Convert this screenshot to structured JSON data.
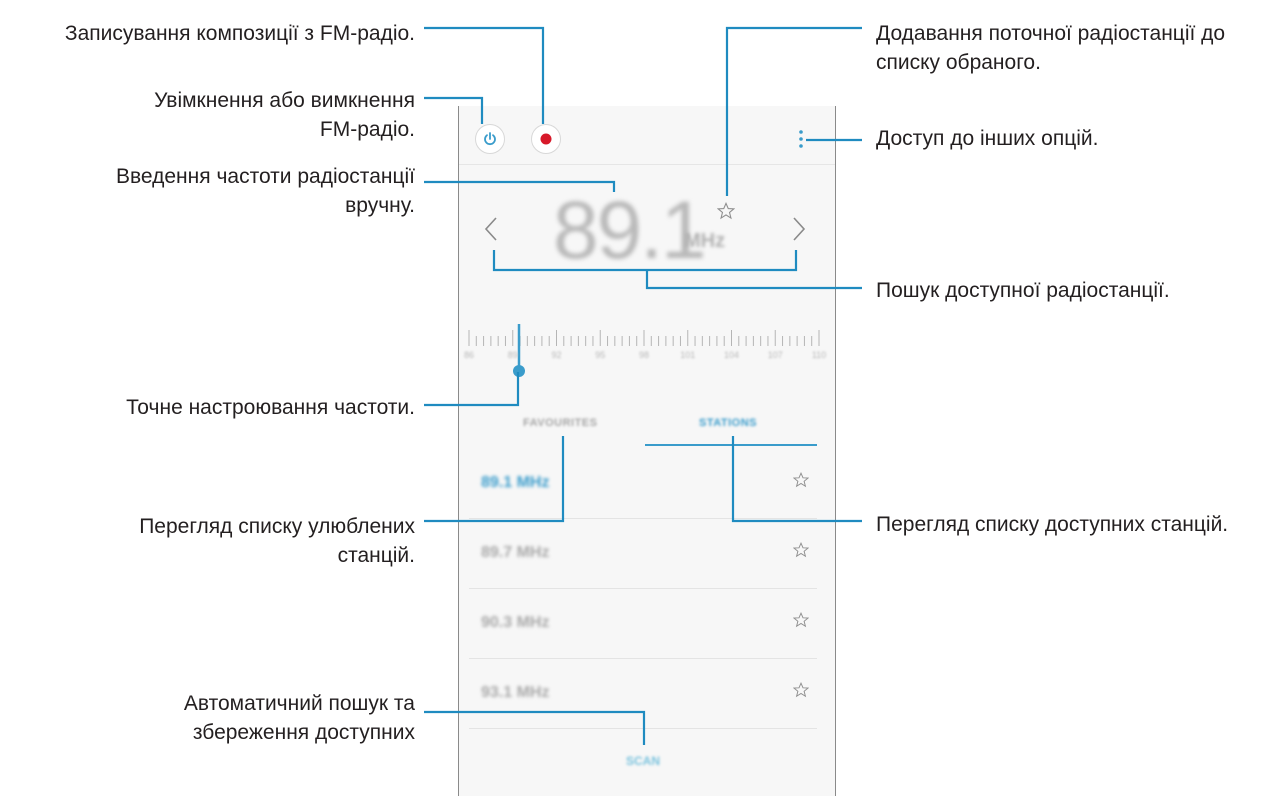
{
  "callouts": {
    "record": [
      "Записування композиції з FM-радіо."
    ],
    "power": [
      "Увімкнення або вимкнення",
      "FM-радіо."
    ],
    "manual_freq": [
      "Введення частоти радіостанції",
      "вручну."
    ],
    "fine_tune": [
      "Точне настроювання частоти."
    ],
    "favourites_list": [
      "Перегляд списку улюблених",
      "станцій."
    ],
    "auto_scan": [
      "Автоматичний пошук та",
      "збереження доступних"
    ],
    "add_favourite": [
      "Додавання поточної радіостанції до",
      "списку обраного."
    ],
    "more_options": [
      "Доступ до інших опцій."
    ],
    "search_station": [
      "Пошук доступної радіостанції."
    ],
    "stations_list": [
      "Перегляд списку доступних станцій."
    ]
  },
  "radio": {
    "frequency": "89.1",
    "unit": "MHz",
    "scale_labels": [
      "86",
      "89",
      "92",
      "95",
      "98",
      "101",
      "104",
      "107",
      "110"
    ],
    "tabs": {
      "favourites": "FAVOURITES",
      "stations": "STATIONS"
    },
    "stations": [
      {
        "freq": "89.1 MHz",
        "active": true
      },
      {
        "freq": "89.7 MHz",
        "active": false
      },
      {
        "freq": "90.3 MHz",
        "active": false
      },
      {
        "freq": "93.1 MHz",
        "active": false
      }
    ],
    "scan_label": "SCAN"
  },
  "colors": {
    "accent": "#3a9ccb",
    "record": "#d7192a",
    "leader": "#1f8bc0"
  }
}
